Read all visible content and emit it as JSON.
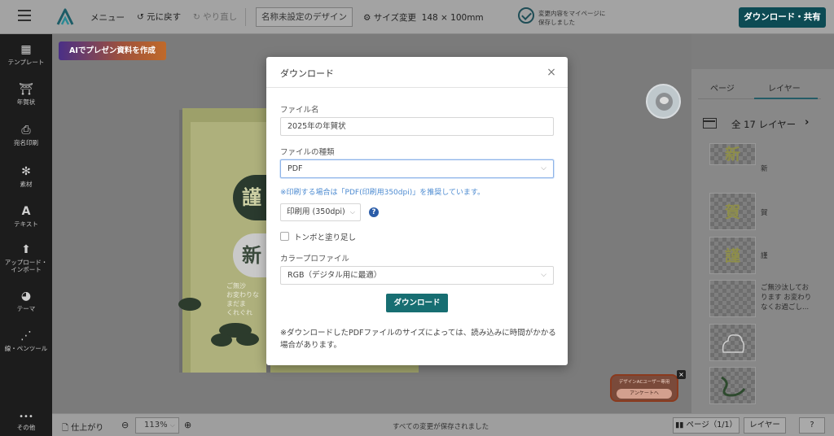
{
  "topbar": {
    "menu": "メニュー",
    "undo": "元に戻す",
    "redo": "やり直し",
    "design_name": "名称未設定のデザイン",
    "size_label": "サイズ変更",
    "size_value": "148 × 100mm",
    "autosave_line1": "変更内容をマイページに",
    "autosave_line2": "保存しました",
    "download_share": "ダウンロード・共有"
  },
  "sidebar": {
    "items": [
      {
        "label": "テンプレート",
        "icon": "template-icon"
      },
      {
        "label": "年賀状",
        "icon": "newyear-card-icon"
      },
      {
        "label": "宛名印刷",
        "icon": "printer-icon"
      },
      {
        "label": "素材",
        "icon": "material-icon"
      },
      {
        "label": "テキスト",
        "icon": "text-icon"
      },
      {
        "label": "アップロード・",
        "label2": "インポート",
        "icon": "upload-icon"
      },
      {
        "label": "テーマ",
        "icon": "palette-icon"
      },
      {
        "label": "線・ペンツール",
        "icon": "pen-tool-icon"
      },
      {
        "label": "その他",
        "icon": "more-icon"
      }
    ]
  },
  "workspace": {
    "ai_banner": "AIでプレゼン資料を作成",
    "card_seal_1": "謹",
    "card_seal_2": "新",
    "card_text_1": "ご無沙",
    "card_text_2": "お変わりな",
    "card_text_3": "まだま",
    "card_text_4": "くれぐれ",
    "survey_title": "デザインACユーザー専用",
    "survey_button": "アンケートへ",
    "survey_close": "×"
  },
  "right_panel": {
    "tab_page": "ページ",
    "tab_layer": "レイヤー",
    "layer_count": "全 17 レイヤー",
    "layers": [
      {
        "glyph": "新",
        "name": "新"
      },
      {
        "glyph": "賀",
        "name": "賀"
      },
      {
        "glyph": "謹",
        "name": "謹"
      },
      {
        "glyph": "",
        "name": "ご無沙汰しております お変わりなくお過ごし..."
      },
      {
        "glyph": "",
        "name": ""
      },
      {
        "glyph": "",
        "name": ""
      }
    ]
  },
  "bottombar": {
    "finish": "仕上がり",
    "zoom": "113%",
    "saved_all": "すべての変更が保存されました",
    "page": "ページ（1/1）",
    "layer": "レイヤー",
    "help": "?"
  },
  "modal": {
    "title": "ダウンロード",
    "close": "×",
    "file_name_label": "ファイル名",
    "file_name_value": "2025年の年賀状",
    "file_type_label": "ファイルの種類",
    "file_type_value": "PDF",
    "hint": "※印刷する場合は「PDF(印刷用350dpi)」を推奨しています。",
    "resolution_value": "印刷用 (350dpi)",
    "bleed_label": "トンボと塗り足し",
    "bleed_checked": false,
    "color_profile_label": "カラープロファイル",
    "color_profile_value": "RGB（デジタル用に最適）",
    "download_button": "ダウンロード",
    "note": "※ダウンロードしたPDFファイルのサイズによっては、読み込みに時間がかかる場合があります。"
  },
  "colors": {
    "brand_teal": "#176e72",
    "primary_dark_teal": "#0d4b54",
    "hint_blue": "#4d8bd1"
  }
}
